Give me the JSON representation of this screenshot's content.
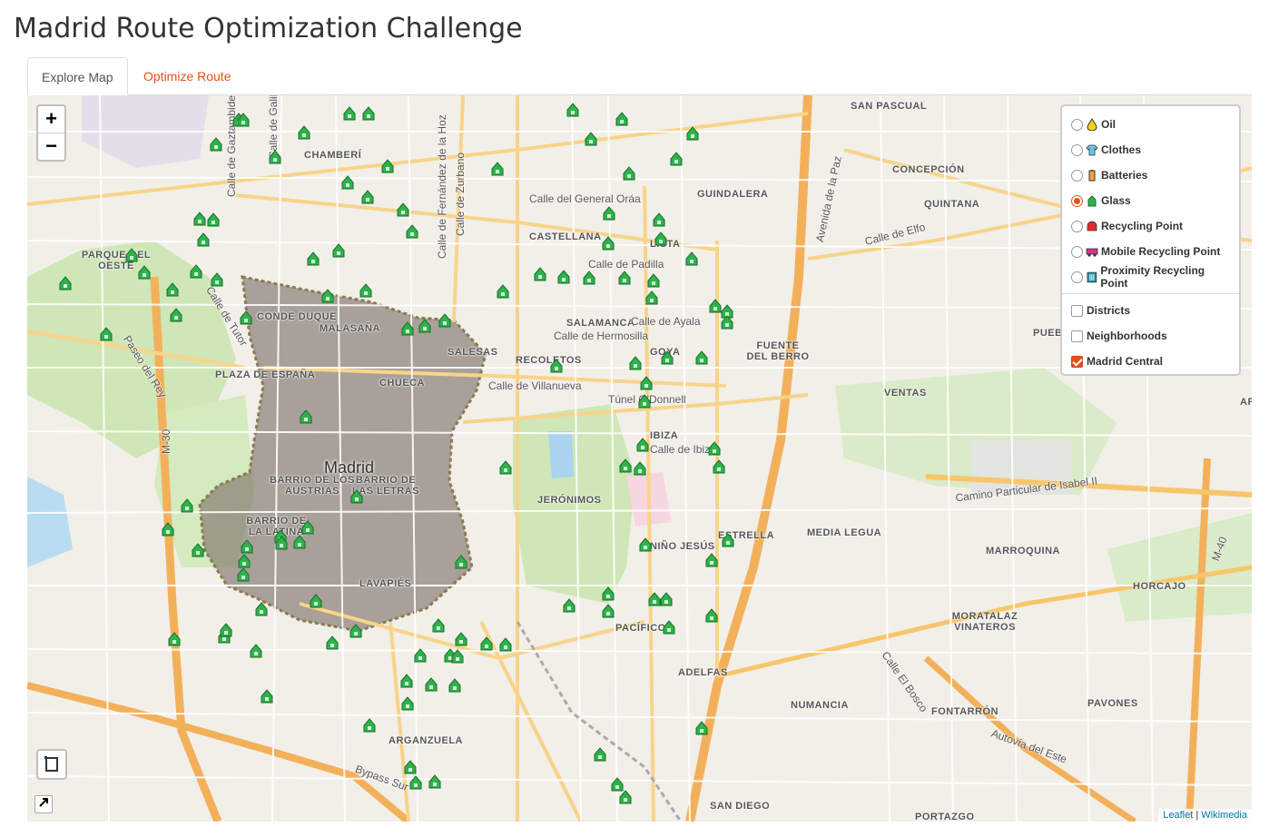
{
  "title": "Madrid Route Optimization Challenge",
  "tabs": [
    {
      "label": "Explore Map",
      "active": true
    },
    {
      "label": "Optimize Route",
      "active": false
    }
  ],
  "map": {
    "zoom_in": "+",
    "zoom_out": "−",
    "city": "Madrid",
    "neighborhoods": [
      "CHAMBERÍ",
      "GUINDALERA",
      "SAN PASCUAL",
      "CONCEPCIÓN",
      "QUINTANA",
      "CASTELLANA",
      "LISTA",
      "PARQUE DEL OESTE",
      "CONDE DUQUE",
      "MALASAÑA",
      "SALESAS",
      "SALAMANCA",
      "RECOLETOS",
      "GOYA",
      "FUENTE DEL BERRO",
      "PLAZA DE ESPAÑA",
      "CHUECA",
      "VENTAS",
      "IBIZA",
      "BARRIO DE LOS AUSTRIAS",
      "BARRIO DE LAS LETRAS",
      "JERÓNIMOS",
      "BARRIO DE LA LATINA",
      "NIÑO JESÚS",
      "ESTRELLA",
      "MEDIA LEGUA",
      "MARROQUINA",
      "LAVAPIÉS",
      "HORCAJO",
      "PACÍFICO",
      "MORATALAZ VINATEROS",
      "ADELFAS",
      "NUMANCIA",
      "FONTARRÓN",
      "PAVONES",
      "ARGANZUELA",
      "SAN DIEGO",
      "PORTAZGO",
      "PUEB",
      "AR"
    ],
    "streets": [
      "Calle de Galileo",
      "Calle de Gaztambide",
      "Calle de Fernández de la Hoz",
      "Calle de Zurbano",
      "Calle del General Oráa",
      "Calle de Padilla",
      "Calle de Ayala",
      "Calle de Hermosilla",
      "Calle de Villanueva",
      "Calle de Ibiza",
      "Calle de Elfo",
      "Avenida de la Paz",
      "Paseo del Rey",
      "Calle de Tutor",
      "Túnel O'Donnell",
      "Camino Particular de Isabel II",
      "Autovía del Este",
      "Bypass Sur",
      "Calle El Bosco",
      "M-30",
      "M-40"
    ],
    "layers": {
      "base": [
        {
          "label": "Oil",
          "selected": false,
          "icon": "oil-icon"
        },
        {
          "label": "Clothes",
          "selected": false,
          "icon": "clothes-icon"
        },
        {
          "label": "Batteries",
          "selected": false,
          "icon": "batteries-icon"
        },
        {
          "label": "Glass",
          "selected": true,
          "icon": "glass-icon"
        },
        {
          "label": "Recycling Point",
          "selected": false,
          "icon": "recycling-point-icon"
        },
        {
          "label": "Mobile Recycling Point",
          "selected": false,
          "icon": "mobile-recycling-icon"
        },
        {
          "label": "Proximity Recycling Point",
          "selected": false,
          "icon": "proximity-recycling-icon"
        }
      ],
      "overlays": [
        {
          "label": "Districts",
          "checked": false
        },
        {
          "label": "Neighborhoods",
          "checked": false
        },
        {
          "label": "Madrid Central",
          "checked": true
        }
      ]
    },
    "attribution": {
      "leaflet": "Leaflet",
      "separator": " | ",
      "tiles": "Wikimedia"
    },
    "colors": {
      "accent": "#e5501a",
      "glass_marker": "#2db34a",
      "madrid_central_fill": "#7a7068",
      "road_major": "#f8c66a",
      "park": "#cde8b5"
    }
  }
}
